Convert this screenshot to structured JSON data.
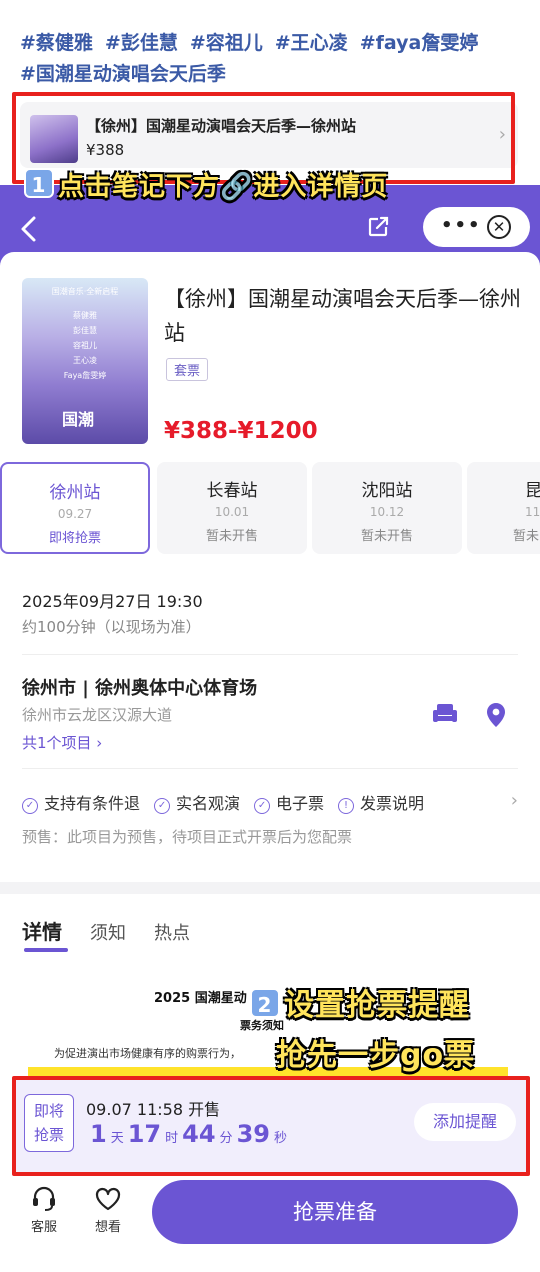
{
  "note": {
    "tags": [
      "#蔡健雅",
      "#彭佳慧",
      "#容祖儿",
      "#王心凌",
      "#faya詹雯婷",
      "#国潮星动演唱会天后季"
    ],
    "card_title": "【徐州】国潮星动演唱会天后季—徐州站",
    "card_price": "¥388"
  },
  "step1": {
    "num": "1",
    "text": "点击笔记下方🔗进入详情页"
  },
  "step2": {
    "num": "2",
    "line1": "设置抢票提醒",
    "line2": "抢先一步go票"
  },
  "header": {
    "more": "•••",
    "close": "✕"
  },
  "event": {
    "title": "【徐州】国潮星动演唱会天后季—徐州站",
    "tag": "套票",
    "price": "¥388-¥1200",
    "poster_lines": [
      "国潮音乐·全新启程",
      "蔡健雅",
      "彭佳慧",
      "容祖儿",
      "王心凌",
      "Faya詹雯婷",
      "国潮"
    ]
  },
  "stations": [
    {
      "city": "徐州站",
      "date": "09.27",
      "status": "即将抢票"
    },
    {
      "city": "长春站",
      "date": "10.01",
      "status": "暂未开售"
    },
    {
      "city": "沈阳站",
      "date": "10.12",
      "status": "暂未开售"
    },
    {
      "city": "昆",
      "date": "11.",
      "status": "暂未"
    }
  ],
  "schedule": {
    "date": "2025年09月27日 19:30",
    "duration": "约100分钟（以现场为准）"
  },
  "venue": {
    "name": "徐州市 | 徐州奥体中心体育场",
    "address": "徐州市云龙区汉源大道",
    "projects": "共1个项目 ›"
  },
  "features": [
    "支持有条件退",
    "实名观演",
    "电子票",
    "发票说明"
  ],
  "presale": "预售：此项目为预售，待项目正式开票后为您配票",
  "tabs": [
    "详情",
    "须知",
    "热点"
  ],
  "doc": {
    "heading": "2025 国潮星动",
    "sub": "票务须知",
    "line": "为促进演出市场健康有序的购票行为，"
  },
  "countdown": {
    "badge_l1": "即将",
    "badge_l2": "抢票",
    "time": "09.07 11:58 开售",
    "days": "1",
    "days_u": "天",
    "hours": "17",
    "hours_u": "时",
    "mins": "44",
    "mins_u": "分",
    "secs": "39",
    "secs_u": "秒",
    "remind": "添加提醒"
  },
  "bottom": {
    "service": "客服",
    "want": "想看",
    "buy": "抢票准备"
  },
  "colors": {
    "primary": "#6b55d3",
    "price": "#e61b2a",
    "highlight": "#e8211d",
    "step_text": "#ffe45c"
  }
}
